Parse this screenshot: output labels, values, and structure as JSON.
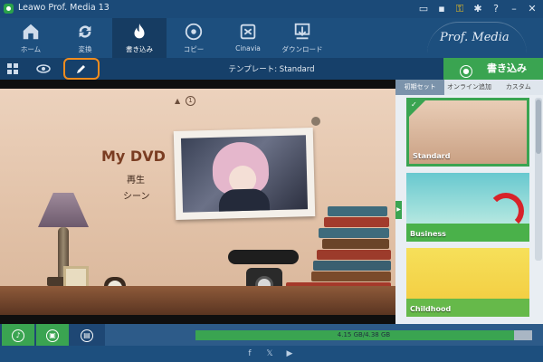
{
  "window": {
    "title": "Leawo Prof. Media 13",
    "controls": [
      "cart-icon",
      "feedback-icon",
      "register-key-icon",
      "settings-icon",
      "help-icon",
      "minimize-icon",
      "close-icon"
    ]
  },
  "nav": {
    "items": [
      {
        "label": "ホーム",
        "icon": "home-icon"
      },
      {
        "label": "変換",
        "icon": "convert-icon"
      },
      {
        "label": "書き込み",
        "icon": "burn-icon",
        "active": true
      },
      {
        "label": "コピー",
        "icon": "copy-icon"
      },
      {
        "label": "Cinavia",
        "icon": "cinavia-icon"
      },
      {
        "label": "ダウンロード",
        "icon": "download-icon"
      }
    ],
    "brand": "Prof. Media"
  },
  "subbar": {
    "template_label": "テンプレート: Standard",
    "burn_button": "書き込み"
  },
  "preview": {
    "title": "My DVD",
    "play": "再生",
    "scenes": "シーン",
    "page_number": "1"
  },
  "templates": {
    "tabs": [
      "初期セット",
      "オンライン追加",
      "カスタム"
    ],
    "items": [
      {
        "name": "Standard",
        "selected": true
      },
      {
        "name": "Business",
        "selected": false
      },
      {
        "name": "Childhood",
        "selected": false
      }
    ]
  },
  "status": {
    "disk_usage": "4.15 GB/4.38 GB",
    "progress": 0.947
  },
  "social": [
    "facebook-icon",
    "x-icon",
    "youtube-icon"
  ],
  "colors": {
    "primary_bg": "#1d4f7e",
    "accent_green": "#3aa451",
    "highlight_orange": "#f08c1e"
  }
}
